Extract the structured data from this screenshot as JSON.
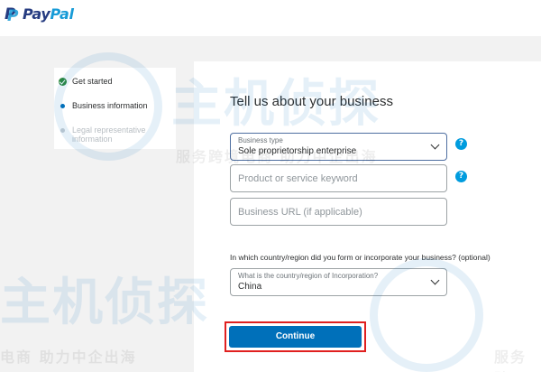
{
  "header": {
    "logo_pay": "Pay",
    "logo_pal": "Pal",
    "logo_icon": "paypal-p-icon"
  },
  "sidebar": {
    "steps": [
      {
        "label": "Get started",
        "state": "complete",
        "icon": "check-icon"
      },
      {
        "label": "Business information",
        "state": "active",
        "icon": "dot-icon"
      },
      {
        "label": "Legal representative information",
        "state": "pending",
        "icon": "dot-icon"
      }
    ]
  },
  "form": {
    "title": "Tell us about your business",
    "business_type": {
      "label": "Business type",
      "value": "Sole proprietorship enterprise"
    },
    "product_keyword": {
      "placeholder": "Product or service keyword"
    },
    "business_url": {
      "placeholder": "Business URL (if applicable)"
    },
    "country_question": "In which country/region did you form or incorporate your business? (optional)",
    "country": {
      "label": "What is the country/region of Incorporation?",
      "value": "China"
    },
    "help_glyph": "?",
    "continue_label": "Continue"
  },
  "watermark": {
    "brand": "主机侦探",
    "slogan_top": "服务跨境电商 助力中企出海",
    "slogan_left": "电商 助力中企出海",
    "slogan_right": "服务跨"
  },
  "colors": {
    "primary": "#0070ba",
    "help": "#009cde",
    "success": "#2d8a3e",
    "highlight_border": "#e0201f",
    "background": "#f2f2f2"
  }
}
